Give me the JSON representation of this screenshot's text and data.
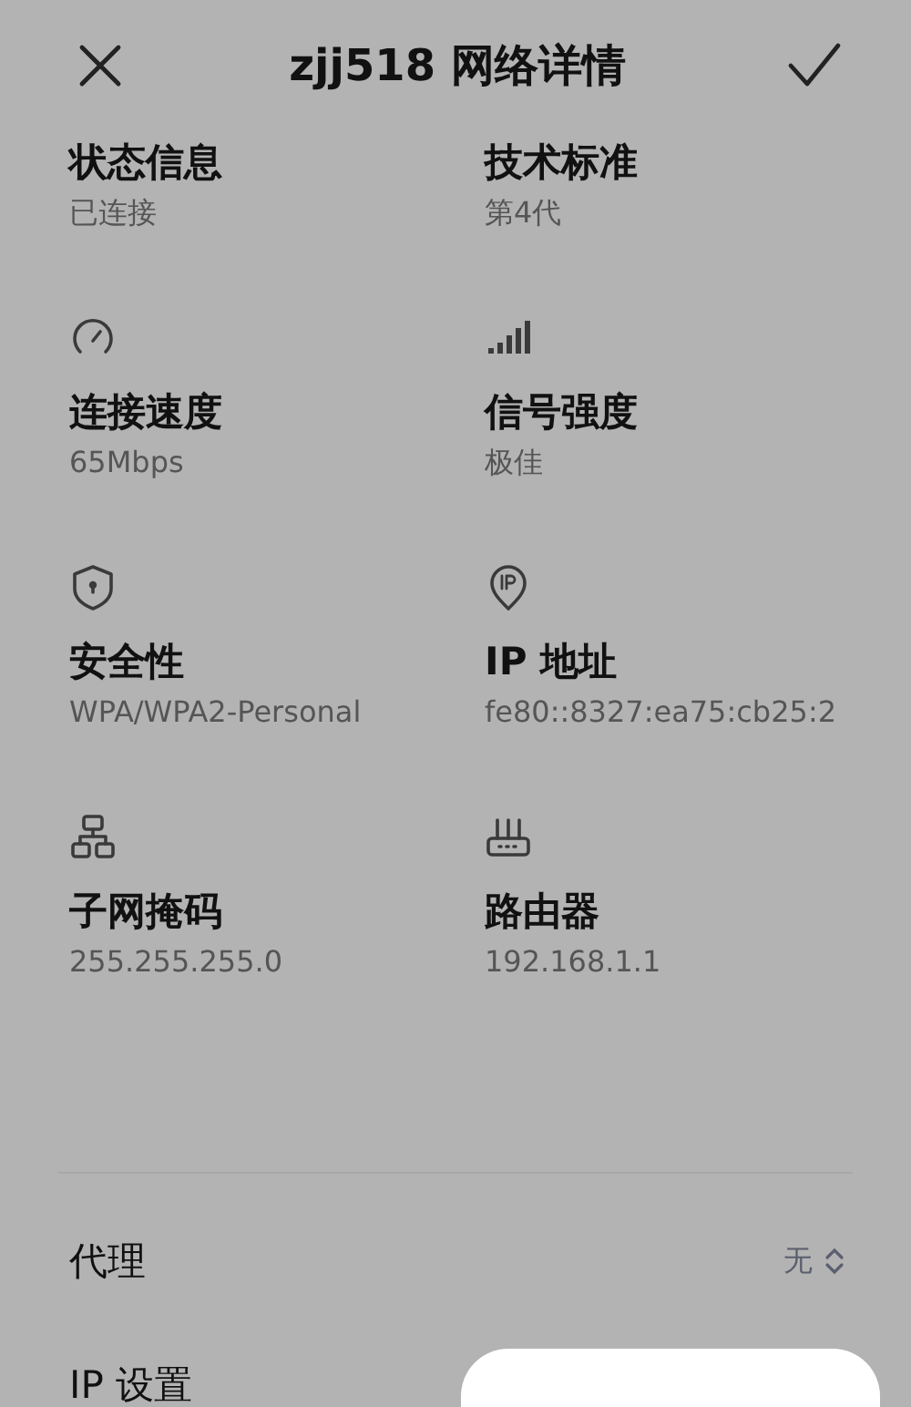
{
  "header": {
    "title": "zjj518 网络详情"
  },
  "details": [
    {
      "label": "状态信息",
      "value": "已连接"
    },
    {
      "label": "技术标准",
      "value": "第4代"
    },
    {
      "label": "连接速度",
      "value": "65Mbps"
    },
    {
      "label": "信号强度",
      "value": "极佳"
    },
    {
      "label": "安全性",
      "value": "WPA/WPA2-Personal"
    },
    {
      "label": "IP 地址",
      "value": "fe80::8327:ea75:cb25:2"
    },
    {
      "label": "子网掩码",
      "value": "255.255.255.0"
    },
    {
      "label": "路由器",
      "value": "192.168.1.1"
    }
  ],
  "settings": [
    {
      "label": "代理",
      "value": "无"
    },
    {
      "label": "IP 设置"
    }
  ]
}
